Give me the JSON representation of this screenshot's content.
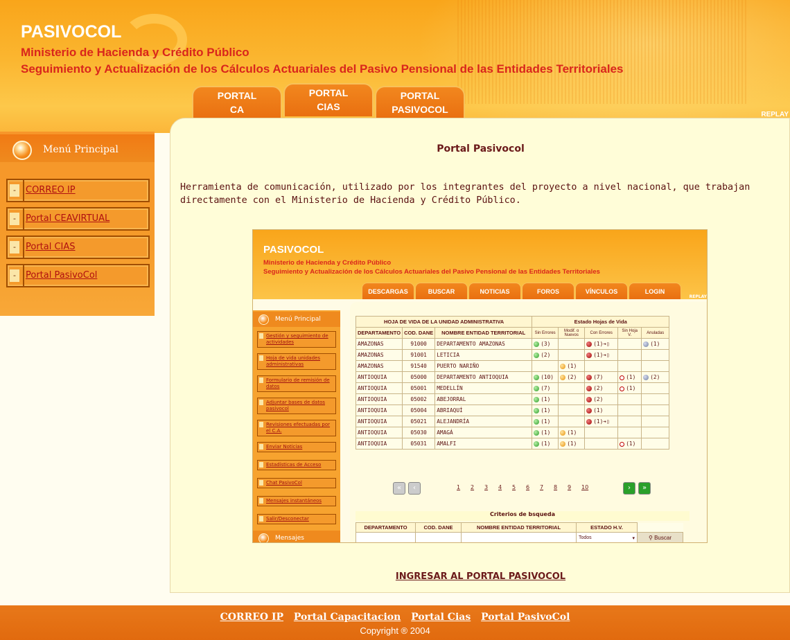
{
  "header": {
    "title": "PASIVOCOL",
    "subtitle1": "Ministerio de Hacienda y Crédito Público",
    "subtitle2": "Seguimiento y Actualización de los Cálculos Actuariales del Pasivo Pensional de las Entidades Territoriales",
    "replay": "REPLAY"
  },
  "tabs": [
    {
      "l1": "PORTAL",
      "l2": "CA"
    },
    {
      "l1": "PORTAL",
      "l2": "CIAS"
    },
    {
      "l1": "PORTAL",
      "l2": "PASIVOCOL"
    }
  ],
  "sidebar": {
    "title": "Menú Principal",
    "items": [
      {
        "label": "CORREO IP"
      },
      {
        "label": "Portal CEAVIRTUAL"
      },
      {
        "label": "Portal CIAS"
      },
      {
        "label": "Portal PasivoCol"
      }
    ],
    "bullet": "-"
  },
  "main": {
    "title": "Portal Pasivocol",
    "description": "Herramienta de comunicación, utilizado por los integrantes del proyecto a nivel nacional, que trabajan directamente con el Ministerio de Hacienda y Crédito Público.",
    "enter_link": "INGRESAR AL PORTAL PASIVOCOL"
  },
  "preview": {
    "title": "PASIVOCOL",
    "subtitle1": "Ministerio de Hacienda y Crédito Público",
    "subtitle2": "Seguimiento y Actualización de los Cálculos Actuariales del Pasivo Pensional de las Entidades Territoriales",
    "replay": "REPLAY",
    "tabs": [
      "DESCARGAS",
      "BUSCAR",
      "NOTICIAS",
      "FOROS",
      "VÍNCULOS",
      "LOGIN"
    ],
    "menu_title": "Menú Principal",
    "menu": [
      "Gestión y seguimiento de actividades",
      "Hoja de vida unidades administrativas",
      "Formulario de remisión de datos",
      "Adjuntar bases de datos pasivocol",
      "Revisiones efectuadas por el C.A.",
      "Enviar Noticias",
      "Estadísticas de Acceso",
      "Chat PasivoCol",
      "Mensajes instantáneos",
      "Salir/Desconectar"
    ],
    "messages": "Mensajes",
    "table_title": "HOJA DE VIDA DE LA UNIDAD ADMINISTRATIVA",
    "status_title": "Estado Hojas de Vida",
    "cols": [
      "DEPARTAMENTO",
      "COD. DANE",
      "NOMBRE ENTIDAD TERRITORIAL"
    ],
    "status_cols": [
      "Sin Errores",
      "Modif. o Nuevos",
      "Con Errores",
      "Sin Hoja V.",
      "Anuladas"
    ],
    "rows": [
      {
        "dep": "AMAZONAS",
        "cod": "91000",
        "nom": "DEPARTAMENTO AMAZONAS",
        "s1": "(3)",
        "s2": "",
        "s3": "(1)➔▯",
        "s4": "",
        "s5": "(1)"
      },
      {
        "dep": "AMAZONAS",
        "cod": "91001",
        "nom": "LETICIA",
        "s1": "(2)",
        "s2": "",
        "s3": "(1)➔▯",
        "s4": "",
        "s5": ""
      },
      {
        "dep": "AMAZONAS",
        "cod": "91540",
        "nom": "PUERTO NARIÑO",
        "s1": "",
        "s2": "(1)",
        "s3": "",
        "s4": "",
        "s5": ""
      },
      {
        "dep": "ANTIOQUIA",
        "cod": "05000",
        "nom": "DEPARTAMENTO ANTIOQUIA",
        "s1": "(10)",
        "s2": "(2)",
        "s3": "(7)",
        "s4": "(1)",
        "s5": "(2)"
      },
      {
        "dep": "ANTIOQUIA",
        "cod": "05001",
        "nom": "MEDELLÍN",
        "s1": "(7)",
        "s2": "",
        "s3": "(2)",
        "s4": "(1)",
        "s5": ""
      },
      {
        "dep": "ANTIOQUIA",
        "cod": "05002",
        "nom": "ABEJORRAL",
        "s1": "(1)",
        "s2": "",
        "s3": "(2)",
        "s4": "",
        "s5": ""
      },
      {
        "dep": "ANTIOQUIA",
        "cod": "05004",
        "nom": "ABRIAQUÍ",
        "s1": "(1)",
        "s2": "",
        "s3": "(1)",
        "s4": "",
        "s5": ""
      },
      {
        "dep": "ANTIOQUIA",
        "cod": "05021",
        "nom": "ALEJANDRÍA",
        "s1": "(1)",
        "s2": "",
        "s3": "(1)➔▯",
        "s4": "",
        "s5": ""
      },
      {
        "dep": "ANTIOQUIA",
        "cod": "05030",
        "nom": "AMAGÁ",
        "s1": "(1)",
        "s2": "(1)",
        "s3": "",
        "s4": "",
        "s5": ""
      },
      {
        "dep": "ANTIOQUIA",
        "cod": "05031",
        "nom": "AMALFI",
        "s1": "(1)",
        "s2": "(1)",
        "s3": "",
        "s4": "(1)",
        "s5": ""
      }
    ],
    "pages": [
      "1",
      "2",
      "3",
      "4",
      "5",
      "6",
      "7",
      "8",
      "9",
      "10"
    ],
    "criteria_title": "Criterios de bsqueda",
    "criteria_cols": [
      "DEPARTAMENTO",
      "COD. DANE",
      "NOMBRE ENTIDAD TERRITORIAL",
      "ESTADO H.V."
    ],
    "state_value": "Todos",
    "search_label": "Buscar"
  },
  "footer": {
    "links": [
      "CORREO IP",
      "Portal Capacitacion",
      "Portal Cias",
      "Portal PasivoCol"
    ],
    "copyright": "Copyright ® 2004"
  },
  "colors": {
    "accent": "#f7962a",
    "title_red": "#d9261c",
    "text": "#5a1010"
  }
}
